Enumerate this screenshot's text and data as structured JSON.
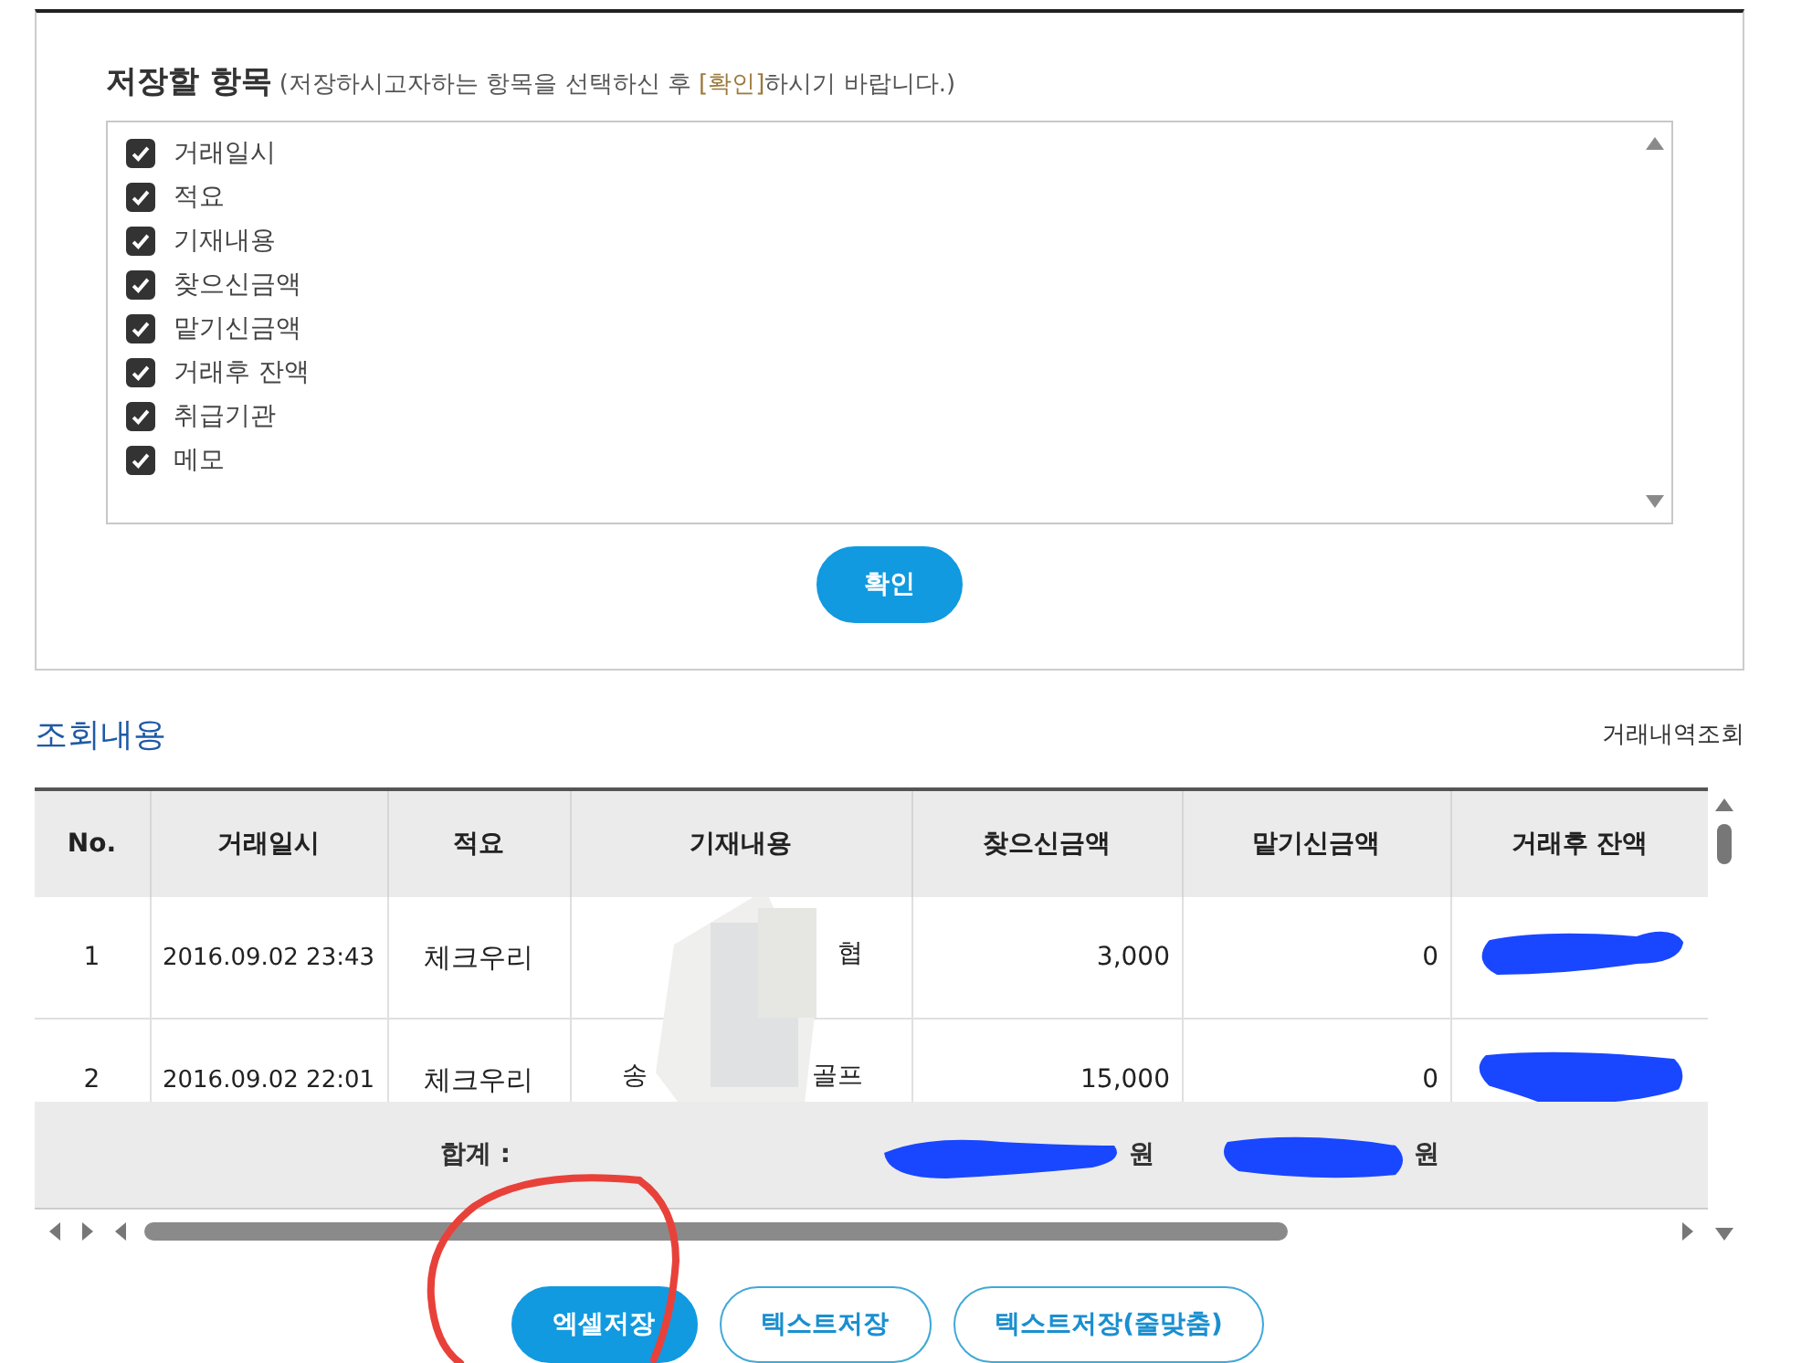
{
  "save_panel": {
    "title": "저장할 항목",
    "hint_before": "(저장하시고자하는 항목을 선택하신 후 ",
    "hint_link": "[확인]",
    "hint_after": "하시기 바랍니다.)",
    "items": [
      {
        "label": "거래일시",
        "checked": true
      },
      {
        "label": "적요",
        "checked": true
      },
      {
        "label": "기재내용",
        "checked": true
      },
      {
        "label": "찾으신금액",
        "checked": true
      },
      {
        "label": "맡기신금액",
        "checked": true
      },
      {
        "label": "거래후 잔액",
        "checked": true
      },
      {
        "label": "취급기관",
        "checked": true
      },
      {
        "label": "메모",
        "checked": true
      }
    ],
    "confirm_button": "확인"
  },
  "results": {
    "title": "조회내용",
    "link": "거래내역조회",
    "columns": [
      "No.",
      "거래일시",
      "적요",
      "기재내용",
      "찾으신금액",
      "맡기신금액",
      "거래후 잔액"
    ],
    "rows": [
      {
        "no": "1",
        "datetime": "2016.09.02 23:43",
        "summary": "체크우리",
        "memo_start": "",
        "memo_end": "협",
        "withdrawn": "3,000",
        "deposited": "0",
        "balance_redacted": true
      },
      {
        "no": "2",
        "datetime": "2016.09.02 22:01",
        "summary": "체크우리",
        "memo_start": "송",
        "memo_end": "골프",
        "withdrawn": "15,000",
        "deposited": "0",
        "balance_redacted": true
      }
    ],
    "total_label": "합계 :",
    "total_withdrawn_unit": "원",
    "total_deposited_unit": "원"
  },
  "buttons": [
    {
      "label": "엑셀저장",
      "primary": true
    },
    {
      "label": "텍스트저장",
      "primary": false
    },
    {
      "label": "텍스트저장(줄맞춤)",
      "primary": false
    }
  ]
}
